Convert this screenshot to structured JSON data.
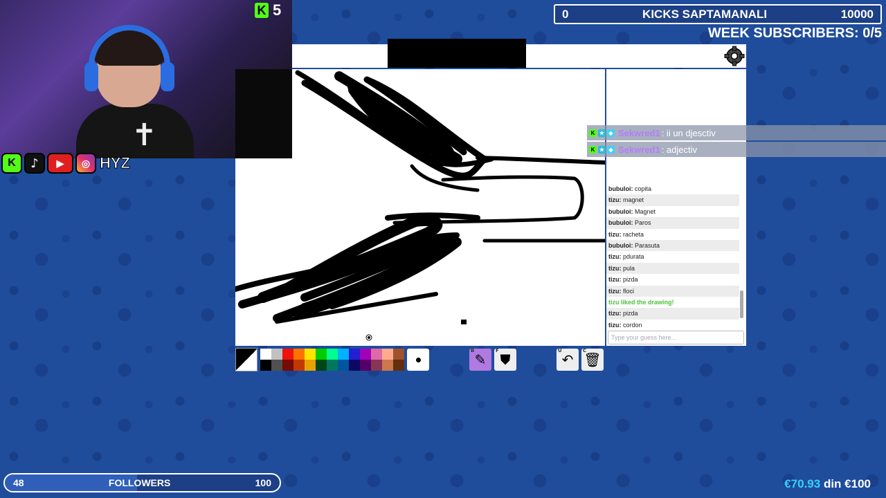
{
  "webcam": {
    "kick_badge_count": "5"
  },
  "socials": {
    "handle": "HYZ",
    "icons": [
      "kick-icon",
      "tiktok-icon",
      "youtube-icon",
      "instagram-icon"
    ]
  },
  "goal": {
    "current": "0",
    "title": "KICKS SAPTAMANALI",
    "target": "10000"
  },
  "week_subscribers": "WEEK SUBSCRIBERS: 0/5",
  "overlay_chat": [
    {
      "user": "Sekwred1",
      "message": ": ii un djesctiv"
    },
    {
      "user": "Sekwred1",
      "message": ": adjectiv"
    }
  ],
  "game_chat": [
    {
      "user": "bubuloi:",
      "text": "copita"
    },
    {
      "user": "tizu:",
      "text": "magnet"
    },
    {
      "user": "bubuloi:",
      "text": "Magnet"
    },
    {
      "user": "bubuloi:",
      "text": "Paros"
    },
    {
      "user": "tizu:",
      "text": "racheta"
    },
    {
      "user": "bubuloi:",
      "text": "Parasuta"
    },
    {
      "user": "tizu:",
      "text": "pdurata"
    },
    {
      "user": "tizu:",
      "text": "pula"
    },
    {
      "user": "tizu:",
      "text": "pizda"
    },
    {
      "user": "tizu:",
      "text": "floci"
    },
    {
      "system": "tizu liked the drawing!"
    },
    {
      "user": "tizu:",
      "text": "pizda"
    },
    {
      "user": "tizu:",
      "text": "cordon"
    }
  ],
  "guess_input": {
    "placeholder": "Type your guess here..."
  },
  "toolbar": {
    "palette_top": [
      "#ffffff",
      "#c1c1c1",
      "#ef130b",
      "#ff7100",
      "#ffe400",
      "#00cc00",
      "#00ff91",
      "#00b2ff",
      "#231fd3",
      "#a300ba",
      "#df69a7",
      "#ffac8e",
      "#a0522d"
    ],
    "palette_bottom": [
      "#000000",
      "#505050",
      "#740b07",
      "#c23800",
      "#e8a200",
      "#004619",
      "#00785d",
      "#00569e",
      "#0e0865",
      "#550069",
      "#873554",
      "#cc774d",
      "#63300d"
    ],
    "pen_key": "B",
    "fill_key": "F",
    "undo_key": "U",
    "clear_key": "C"
  },
  "followers": {
    "current": "48",
    "label": "FOLLOWERS",
    "target": "100",
    "fraction": 0.48
  },
  "donation": {
    "amount": "€70.93",
    "middle": "din",
    "goal": "€100"
  },
  "colors": {
    "background": "#1f4d9c",
    "accent_green": "#53fc18",
    "donation_blue": "#35d0ff"
  }
}
